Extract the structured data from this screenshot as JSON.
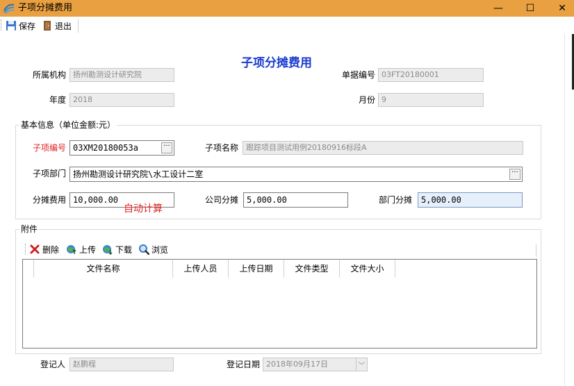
{
  "window": {
    "title": "子项分摊费用",
    "minimize_glyph": "—",
    "maximize_glyph": "☐",
    "close_glyph": "✕"
  },
  "toolbar": {
    "save_label": "保存",
    "exit_label": "退出",
    "save_icon": "floppy-disk-icon",
    "exit_icon": "door-exit-icon"
  },
  "form": {
    "heading": "子项分摊费用",
    "org_label": "所属机构",
    "org_value": "扬州勘测设计研究院",
    "doc_no_label": "单据编号",
    "doc_no_value": "03FT20180001",
    "year_label": "年度",
    "year_value": "2018",
    "month_label": "月份",
    "month_value": "9"
  },
  "basic_info": {
    "group_title": "基本信息（单位金额:元）",
    "sub_code_label": "子项编号",
    "sub_code_value": "03XM20180053a",
    "sub_name_label": "子项名称",
    "sub_name_value": "跟踪项目测试用例20180916标段A",
    "sub_dept_label": "子项部门",
    "sub_dept_value": "扬州勘测设计研究院\\水工设计二室",
    "alloc_fee_label": "分摊费用",
    "alloc_fee_value": "10,000.00",
    "auto_calc_note": "自动计算",
    "company_alloc_label": "公司分摊",
    "company_alloc_value": "5,000.00",
    "dept_alloc_label": "部门分摊",
    "dept_alloc_value": "5,000.00",
    "ellipsis": "···"
  },
  "attachments": {
    "group_title": "附件",
    "delete_label": "删除",
    "upload_label": "上传",
    "download_label": "下载",
    "browse_label": "浏览",
    "columns": [
      "文件名称",
      "上传人员",
      "上传日期",
      "文件类型",
      "文件大小"
    ]
  },
  "footer": {
    "registrant_label": "登记人",
    "registrant_value": "赵鹏程",
    "reg_date_label": "登记日期",
    "reg_date_value": "2018年09月17日"
  },
  "colors": {
    "titlebar": "#e8a040",
    "heading": "#1a3bd0",
    "required_label": "#e02020"
  }
}
